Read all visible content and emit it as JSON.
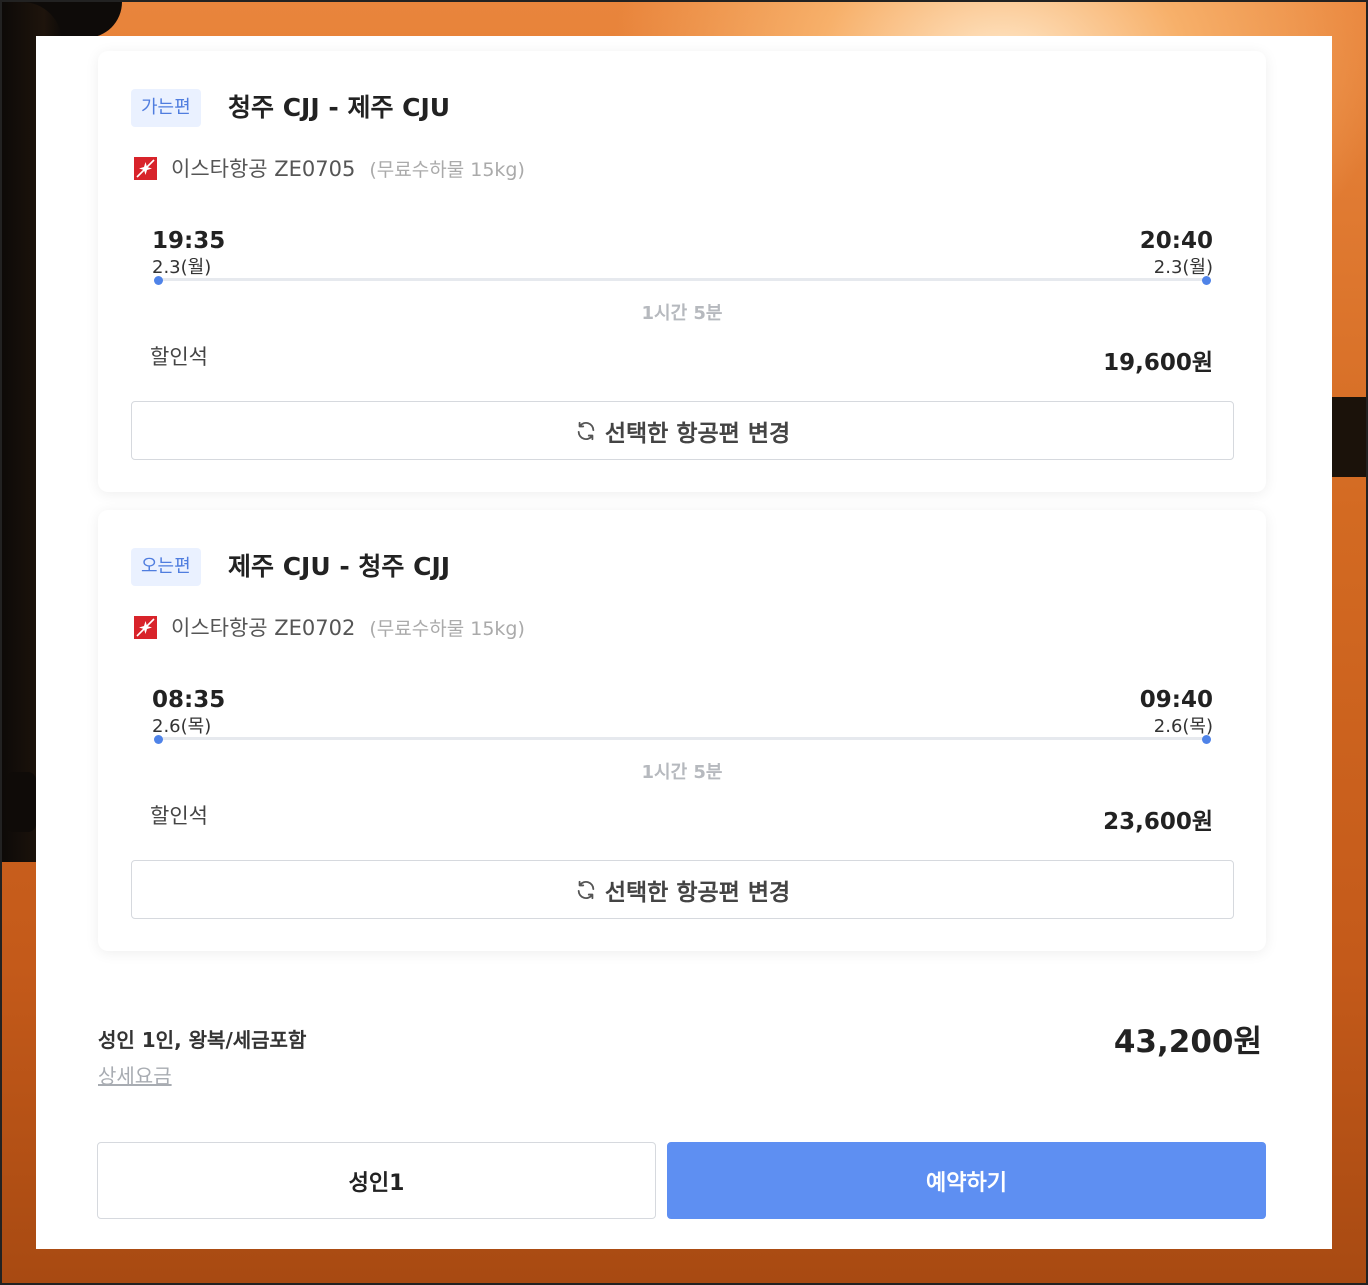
{
  "outbound": {
    "badge": "가는편",
    "route": "청주 CJJ - 제주 CJU",
    "airline": "이스타항공 ZE0705",
    "baggage": "(무료수하물 15kg)",
    "dep_time": "19:35",
    "dep_date": "2.3(월)",
    "arr_time": "20:40",
    "arr_date": "2.3(월)",
    "duration": "1시간 5분",
    "seat_class": "할인석",
    "fare": "19,600원",
    "change_label": "선택한 항공편 변경"
  },
  "return": {
    "badge": "오는편",
    "route": "제주 CJU - 청주 CJJ",
    "airline": "이스타항공 ZE0702",
    "baggage": "(무료수하물 15kg)",
    "dep_time": "08:35",
    "dep_date": "2.6(목)",
    "arr_time": "09:40",
    "arr_date": "2.6(목)",
    "duration": "1시간 5분",
    "seat_class": "할인석",
    "fare": "23,600원",
    "change_label": "선택한 항공편 변경"
  },
  "summary": {
    "label": "성인 1인, 왕복/세금포함",
    "detail_link": "상세요금",
    "total": "43,200원"
  },
  "actions": {
    "passenger_label": "성인1",
    "book_label": "예약하기"
  },
  "colors": {
    "accent": "#5e8ff2",
    "badge_bg": "#eaf1ff",
    "badge_text": "#4f7ddf",
    "airline_logo": "#d8232a"
  },
  "icons": {
    "airline": "eastar-jet-logo-icon",
    "change": "refresh-icon"
  }
}
